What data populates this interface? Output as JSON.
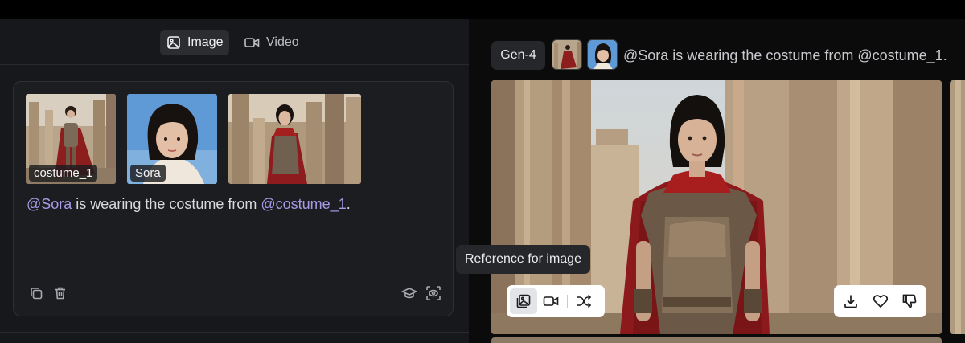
{
  "colors": {
    "mention": "#a89ae6",
    "panel_bg": "#17181b",
    "card_bg": "#1c1d21",
    "canvas_bg": "#0b0b0c",
    "toolbar_bg": "#ffffff"
  },
  "mode_tabs": [
    {
      "label": "Image",
      "icon": "image-icon",
      "active": true
    },
    {
      "label": "Video",
      "icon": "video-camera-icon",
      "active": false
    }
  ],
  "references": [
    {
      "label": "costume_1"
    },
    {
      "label": "Sora"
    },
    {
      "label": ""
    }
  ],
  "prompt": {
    "mention_1": "@Sora",
    "text_1": " is wearing the costume from ",
    "mention_2": "@costume_1",
    "text_2": "."
  },
  "card_icons": {
    "left": [
      "copy-icon",
      "trash-icon"
    ],
    "right": [
      "graduation-cap-icon",
      "scan-face-icon"
    ]
  },
  "output": {
    "model": "Gen-4",
    "prompt": "@Sora is wearing the costume from @costume_1."
  },
  "tooltip": "Reference for image",
  "image_toolbar": [
    "use-as-reference-icon",
    "video-camera-icon",
    "shuffle-icon"
  ],
  "action_toolbar": [
    "download-icon",
    "heart-icon",
    "thumbs-down-icon"
  ]
}
